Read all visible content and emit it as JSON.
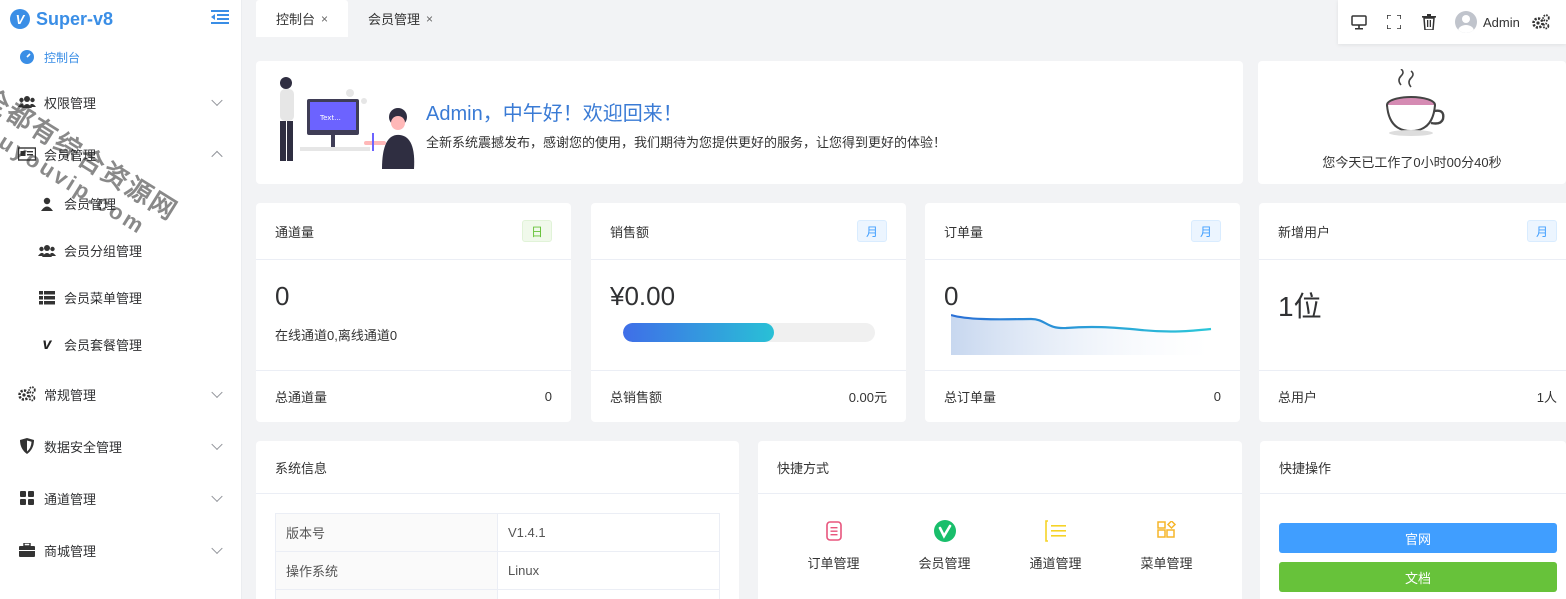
{
  "brand": {
    "name": "Super-v8",
    "logo_letter": "V"
  },
  "sidebar": {
    "active_item": "控制台",
    "items": [
      {
        "label": "权限管理",
        "icon": "users-icon",
        "expandable": true
      },
      {
        "label": "会员管理",
        "icon": "id-card-icon",
        "expandable": true,
        "expanded": true
      },
      {
        "label": "会员管理",
        "icon": "user-icon",
        "sub": true
      },
      {
        "label": "会员分组管理",
        "icon": "users-icon",
        "sub": true
      },
      {
        "label": "会员菜单管理",
        "icon": "list-icon",
        "sub": true
      },
      {
        "label": "会员套餐管理",
        "icon": "vimeo-icon",
        "sub": true
      },
      {
        "label": "常规管理",
        "icon": "cogs-icon",
        "expandable": true
      },
      {
        "label": "数据安全管理",
        "icon": "shield-icon",
        "expandable": true
      },
      {
        "label": "通道管理",
        "icon": "grid-icon",
        "expandable": true
      },
      {
        "label": "商城管理",
        "icon": "briefcase-icon",
        "expandable": true
      }
    ]
  },
  "tabs": [
    {
      "label": "控制台",
      "close": "×",
      "active": true
    },
    {
      "label": "会员管理",
      "close": "×",
      "active": false
    }
  ],
  "toolbar": {
    "user_name": "Admin"
  },
  "welcome": {
    "title": "Admin，中午好！欢迎回来！",
    "message": "全新系统震撼发布，感谢您的使用，我们期待为您提供更好的服务，让您得到更好的体验！",
    "screen_text": "Text..."
  },
  "worktime": {
    "text": "您今天已工作了0小时00分40秒"
  },
  "stats": [
    {
      "title": "通道量",
      "badge": "日",
      "badge_color": "green",
      "value": "0",
      "sub": "在线通道0,离线通道0",
      "foot_label": "总通道量",
      "foot_value": "0"
    },
    {
      "title": "销售额",
      "badge": "月",
      "badge_color": "blue",
      "value": "¥0.00",
      "progress": 0.6,
      "foot_label": "总销售额",
      "foot_value": "0.00元"
    },
    {
      "title": "订单量",
      "badge": "月",
      "badge_color": "blue",
      "value": "0",
      "foot_label": "总订单量",
      "foot_value": "0"
    },
    {
      "title": "新增用户",
      "badge": "月",
      "badge_color": "blue",
      "value": "1位",
      "foot_label": "总用户",
      "foot_value": "1人"
    }
  ],
  "system_info": {
    "title": "系统信息",
    "rows": [
      {
        "key": "版本号",
        "value": "V1.4.1"
      },
      {
        "key": "操作系统",
        "value": "Linux"
      }
    ]
  },
  "shortcuts": {
    "title": "快捷方式",
    "items": [
      {
        "label": "订单管理",
        "icon": "order-icon",
        "color": "#e8557d"
      },
      {
        "label": "会员管理",
        "icon": "vimeo-circle-icon",
        "color": "#19be6b"
      },
      {
        "label": "通道管理",
        "icon": "list-lines-icon",
        "color": "#f5d327"
      },
      {
        "label": "菜单管理",
        "icon": "apps-icon",
        "color": "#f5b52a"
      }
    ]
  },
  "quick_ops": {
    "title": "快捷操作",
    "buttons": [
      {
        "label": "官网",
        "color": "#409eff"
      },
      {
        "label": "文档",
        "color": "#67c23a"
      }
    ]
  },
  "watermark": {
    "line1": "全都有综合资源网",
    "line2": "douyouvip.com"
  }
}
